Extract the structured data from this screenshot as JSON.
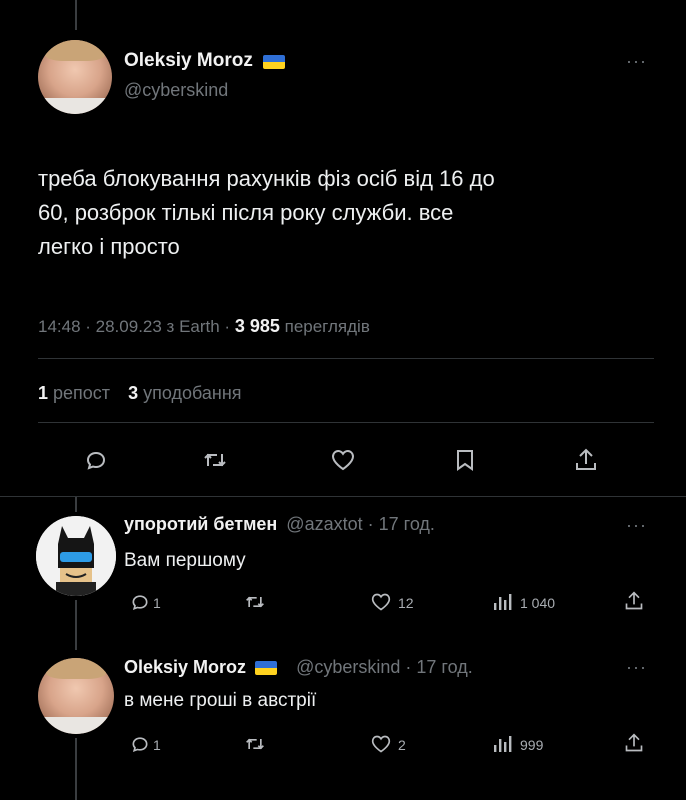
{
  "main_post": {
    "author_name": "Oleksiy Moroz",
    "handle": "@cyberskind",
    "text_line1": "треба блокування рахунків фіз осіб від 16 до",
    "text_line2": "60, розброк тількі після року служби. все",
    "text_line3": "легко і просто",
    "time": "14:48 · 28.09.23 з Earth ·",
    "views_count": "3 985",
    "views_label": "переглядів",
    "reposts_count": "1",
    "reposts_label": "репост",
    "likes_count": "3",
    "likes_label": "уподобання"
  },
  "replies": [
    {
      "author_name": "упоротий бетмен",
      "handle": "@azaxtot",
      "time": "· 17 год.",
      "text": "Вам першому",
      "reply_count": "1",
      "like_count": "12",
      "view_count": "1 040"
    },
    {
      "author_name": "Oleksiy Moroz",
      "handle": "@cyberskind",
      "time": "· 17 год.",
      "text": "в мене гроші в австрії",
      "reply_count": "1",
      "like_count": "2",
      "view_count": "999"
    }
  ],
  "colors": {
    "background": "#000000",
    "text": "#e7e9ea",
    "muted": "#71767b",
    "flag_blue": "#2f6fd6",
    "flag_yellow": "#ffd21f"
  },
  "icons": [
    "reply-icon",
    "repost-icon",
    "like-icon",
    "bookmark-icon",
    "share-icon",
    "views-icon",
    "more-icon"
  ]
}
